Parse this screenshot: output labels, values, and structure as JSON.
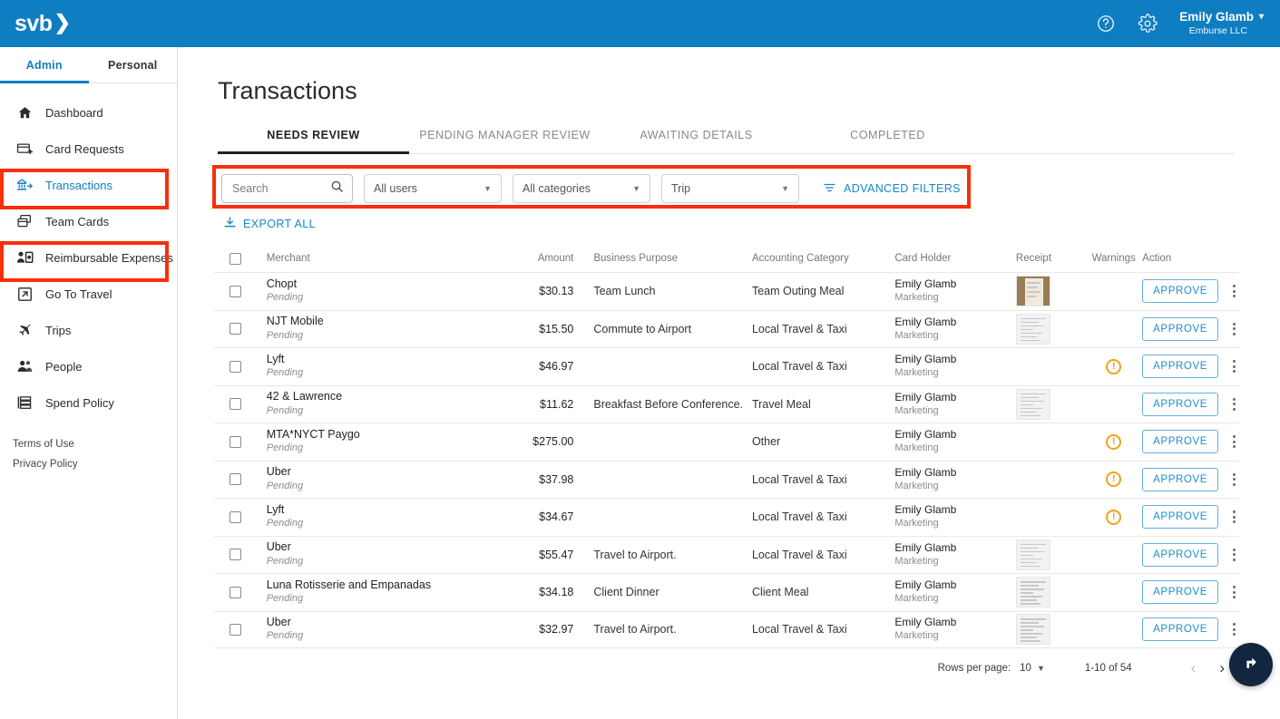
{
  "header": {
    "logo_text": "svb",
    "logo_chevron": "❯",
    "help_icon": "help-circle-icon",
    "settings_icon": "gear-icon",
    "user_name": "Emily Glamb",
    "user_org": "Emburse LLC",
    "user_caret": "▾",
    "brand_color": "#0f7dc2"
  },
  "sidebar": {
    "tabs": [
      {
        "label": "Admin",
        "active": true
      },
      {
        "label": "Personal",
        "active": false
      }
    ],
    "items": [
      {
        "label": "Dashboard",
        "icon": "home-icon",
        "active": false
      },
      {
        "label": "Card Requests",
        "icon": "card-plus-icon",
        "active": false
      },
      {
        "label": "Transactions",
        "icon": "transactions-icon",
        "active": true
      },
      {
        "label": "Team Cards",
        "icon": "team-cards-icon",
        "active": false
      },
      {
        "label": "Reimbursable Expenses",
        "icon": "person-money-icon",
        "active": false
      },
      {
        "label": "Go To Travel",
        "icon": "external-link-icon",
        "active": false
      },
      {
        "label": "Trips",
        "icon": "airplane-icon",
        "active": false
      },
      {
        "label": "People",
        "icon": "people-icon",
        "active": false
      },
      {
        "label": "Spend Policy",
        "icon": "policy-list-icon",
        "active": false
      }
    ],
    "footer_links": [
      {
        "label": "Terms of Use"
      },
      {
        "label": "Privacy Policy"
      }
    ]
  },
  "annotations": {
    "highlight_color": "#f92e0a",
    "boxes": [
      "sidebar-item-transactions",
      "sidebar-item-reimbursable-expenses",
      "filter-bar"
    ]
  },
  "main": {
    "page_title": "Transactions",
    "tabs": [
      {
        "label": "NEEDS REVIEW",
        "active": true
      },
      {
        "label": "PENDING MANAGER REVIEW",
        "active": false
      },
      {
        "label": "AWAITING DETAILS",
        "active": false
      },
      {
        "label": "COMPLETED",
        "active": false
      }
    ],
    "filters": {
      "search_placeholder": "Search",
      "search_value": "",
      "search_icon": "search-icon",
      "users_select": "All users",
      "categories_select": "All categories",
      "trip_select": "Trip",
      "advanced_filters_label": "ADVANCED FILTERS",
      "advanced_filters_icon": "filter-icon",
      "link_color": "#1488cc"
    },
    "export_label": "EXPORT ALL",
    "export_icon": "download-icon"
  },
  "table": {
    "columns": [
      "Merchant",
      "Amount",
      "Business Purpose",
      "Accounting Category",
      "Card Holder",
      "Receipt",
      "Warnings",
      "Action"
    ],
    "action_label": "APPROVE",
    "status_text": "Pending",
    "warning_glyph": "!",
    "rows": [
      {
        "merchant": "Chopt",
        "status": "Pending",
        "amount": "$30.13",
        "purpose": "Team Lunch",
        "category": "Team Outing Meal",
        "holder": "Emily Glamb",
        "department": "Marketing",
        "receipt": "photo",
        "warning": false
      },
      {
        "merchant": "NJT Mobile",
        "status": "Pending",
        "amount": "$15.50",
        "purpose": "Commute to Airport",
        "category": "Local Travel & Taxi",
        "holder": "Emily Glamb",
        "department": "Marketing",
        "receipt": "doc",
        "warning": false
      },
      {
        "merchant": "Lyft",
        "status": "Pending",
        "amount": "$46.97",
        "purpose": "",
        "category": "Local Travel & Taxi",
        "holder": "Emily Glamb",
        "department": "Marketing",
        "receipt": "none",
        "warning": true
      },
      {
        "merchant": "42 & Lawrence",
        "status": "Pending",
        "amount": "$11.62",
        "purpose": "Breakfast Before Conference.",
        "category": "Travel Meal",
        "holder": "Emily Glamb",
        "department": "Marketing",
        "receipt": "doc",
        "warning": false
      },
      {
        "merchant": "MTA*NYCT Paygo",
        "status": "Pending",
        "amount": "$275.00",
        "purpose": "",
        "category": "Other",
        "holder": "Emily Glamb",
        "department": "Marketing",
        "receipt": "none",
        "warning": true
      },
      {
        "merchant": "Uber",
        "status": "Pending",
        "amount": "$37.98",
        "purpose": "",
        "category": "Local Travel & Taxi",
        "holder": "Emily Glamb",
        "department": "Marketing",
        "receipt": "none",
        "warning": true
      },
      {
        "merchant": "Lyft",
        "status": "Pending",
        "amount": "$34.67",
        "purpose": "",
        "category": "Local Travel & Taxi",
        "holder": "Emily Glamb",
        "department": "Marketing",
        "receipt": "none",
        "warning": true
      },
      {
        "merchant": "Uber",
        "status": "Pending",
        "amount": "$55.47",
        "purpose": "Travel to Airport.",
        "category": "Local Travel & Taxi",
        "holder": "Emily Glamb",
        "department": "Marketing",
        "receipt": "doc",
        "warning": false
      },
      {
        "merchant": "Luna Rotisserie and Empanadas",
        "status": "Pending",
        "amount": "$34.18",
        "purpose": "Client Dinner",
        "category": "Client Meal",
        "holder": "Emily Glamb",
        "department": "Marketing",
        "receipt": "doc",
        "warning": false
      },
      {
        "merchant": "Uber",
        "status": "Pending",
        "amount": "$32.97",
        "purpose": "Travel to Airport.",
        "category": "Local Travel & Taxi",
        "holder": "Emily Glamb",
        "department": "Marketing",
        "receipt": "doc",
        "warning": false
      }
    ]
  },
  "pagination": {
    "rows_per_page_label": "Rows per page:",
    "rows_per_page_value": "10",
    "range_label": "1-10 of 54",
    "prev_glyph": "‹",
    "next_glyph": "›"
  },
  "fab": {
    "icon": "send-icon",
    "color": "#12263f"
  }
}
